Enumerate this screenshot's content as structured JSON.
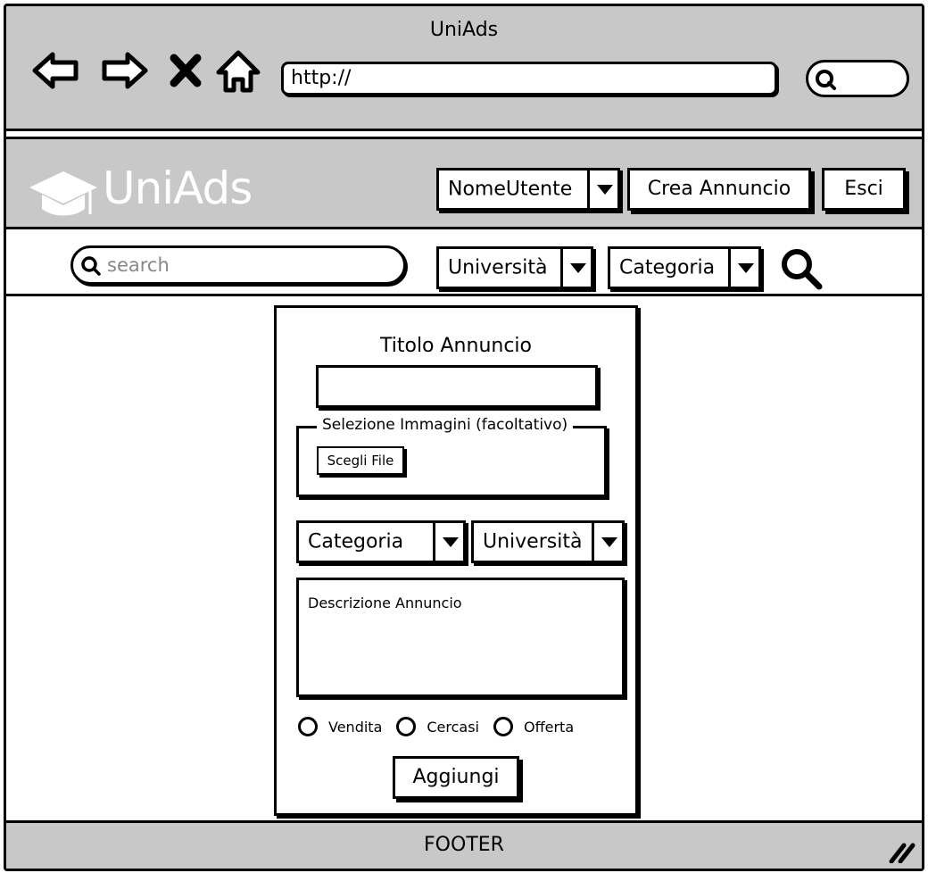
{
  "browser": {
    "title": "UniAds",
    "address": "http://"
  },
  "header": {
    "logo_text": "UniAds",
    "user_menu": "NomeUtente",
    "create_ad_label": "Crea Annuncio",
    "logout_label": "Esci"
  },
  "search": {
    "placeholder": "search",
    "university_filter": "Università",
    "category_filter": "Categoria"
  },
  "form": {
    "title_label": "Titolo Annuncio",
    "images_legend": "Selezione Immagini (facoltativo)",
    "choose_file_label": "Scegli File",
    "category_select": "Categoria",
    "university_select": "Università",
    "description_placeholder": "Descrizione Annuncio",
    "types": [
      "Vendita",
      "Cercasi",
      "Offerta"
    ],
    "submit_label": "Aggiungi"
  },
  "footer": {
    "text": "FOOTER"
  },
  "colors": {
    "chrome_gray": "#c8c8c8",
    "ink": "#000000",
    "paper": "#ffffff"
  },
  "icons": [
    "back-arrow-icon",
    "forward-arrow-icon",
    "close-icon",
    "home-icon",
    "search-icon",
    "graduation-cap-icon",
    "chevron-down-icon",
    "resize-grip-icon"
  ]
}
